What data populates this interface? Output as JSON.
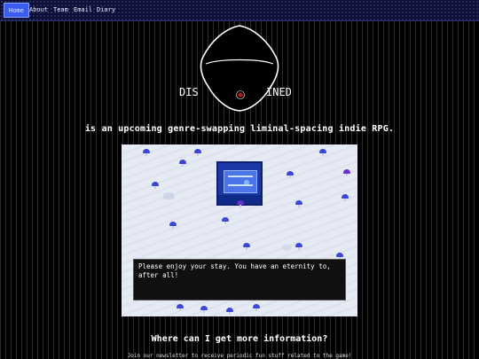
{
  "nav": {
    "items": [
      {
        "label": "Home",
        "active": true
      },
      {
        "label": "About",
        "active": false
      },
      {
        "label": "Team",
        "active": false
      },
      {
        "label": "Email",
        "active": false
      },
      {
        "label": "Diary",
        "active": false
      }
    ]
  },
  "logo": {
    "text_left": "DIS",
    "text_right": "INED"
  },
  "tagline": "is an upcoming genre-swapping liminal-spacing indie RPG.",
  "game_scene": {
    "dialog_text": "Please enjoy your stay. You have an eternity to, after all!"
  },
  "info": {
    "heading": "Where can I get more information?",
    "body": "Join our newsletter to receive periodic fun stuff related to the game!"
  },
  "colors": {
    "nav_active": "#3a5cf0",
    "accent_red": "#d01818",
    "mushroom_blue": "#3b47d6",
    "shrine_blue": "#1b3aa8"
  }
}
